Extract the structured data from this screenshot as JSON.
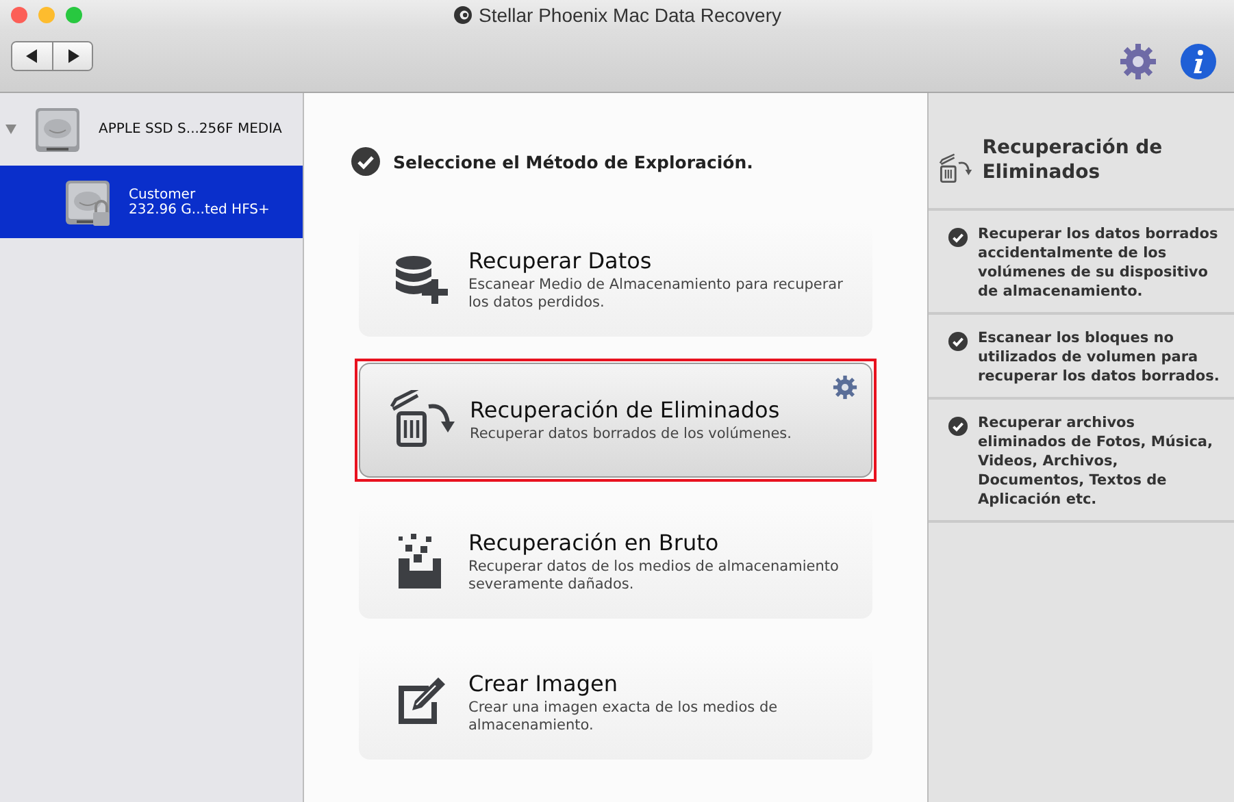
{
  "window": {
    "title": "Stellar Phoenix Mac Data Recovery"
  },
  "devices": [
    {
      "label": "APPLE SSD S...256F MEDIA",
      "kind": "disk",
      "expanded": true,
      "selected": false,
      "children": [
        {
          "label": "Customer",
          "detail": "232.96 G...ted HFS+",
          "kind": "locked-volume",
          "selected": true
        }
      ]
    }
  ],
  "heading": "Seleccione el Método de Exploración.",
  "methods": [
    {
      "kind": "database",
      "title": "Recuperar Datos",
      "description": "Escanear Medio de Almacenamiento para recuperar los datos perdidos.",
      "selected": false
    },
    {
      "kind": "trash",
      "title": "Recuperación de Eliminados",
      "description": "Recuperar datos borrados de los volúmenes.",
      "selected": true
    },
    {
      "kind": "raw",
      "title": "Recuperación en Bruto",
      "description": "Recuperar datos de los medios de almacenamiento severamente dañados.",
      "selected": false
    },
    {
      "kind": "image",
      "title": "Crear Imagen",
      "description": "Crear una imagen exacta de los medios de almacenamiento.",
      "selected": false
    }
  ],
  "details": {
    "title": "Recuperación de Eliminados",
    "points": [
      "Recuperar los datos borrados accidentalmente de los volúmenes de su dispositivo de almacenamiento.",
      "Escanear los bloques no utilizados de volumen para recuperar los datos borrados.",
      "Recuperar archivos eliminados de Fotos, Música, Videos, Archivos, Documentos, Textos de Aplicación etc."
    ]
  }
}
